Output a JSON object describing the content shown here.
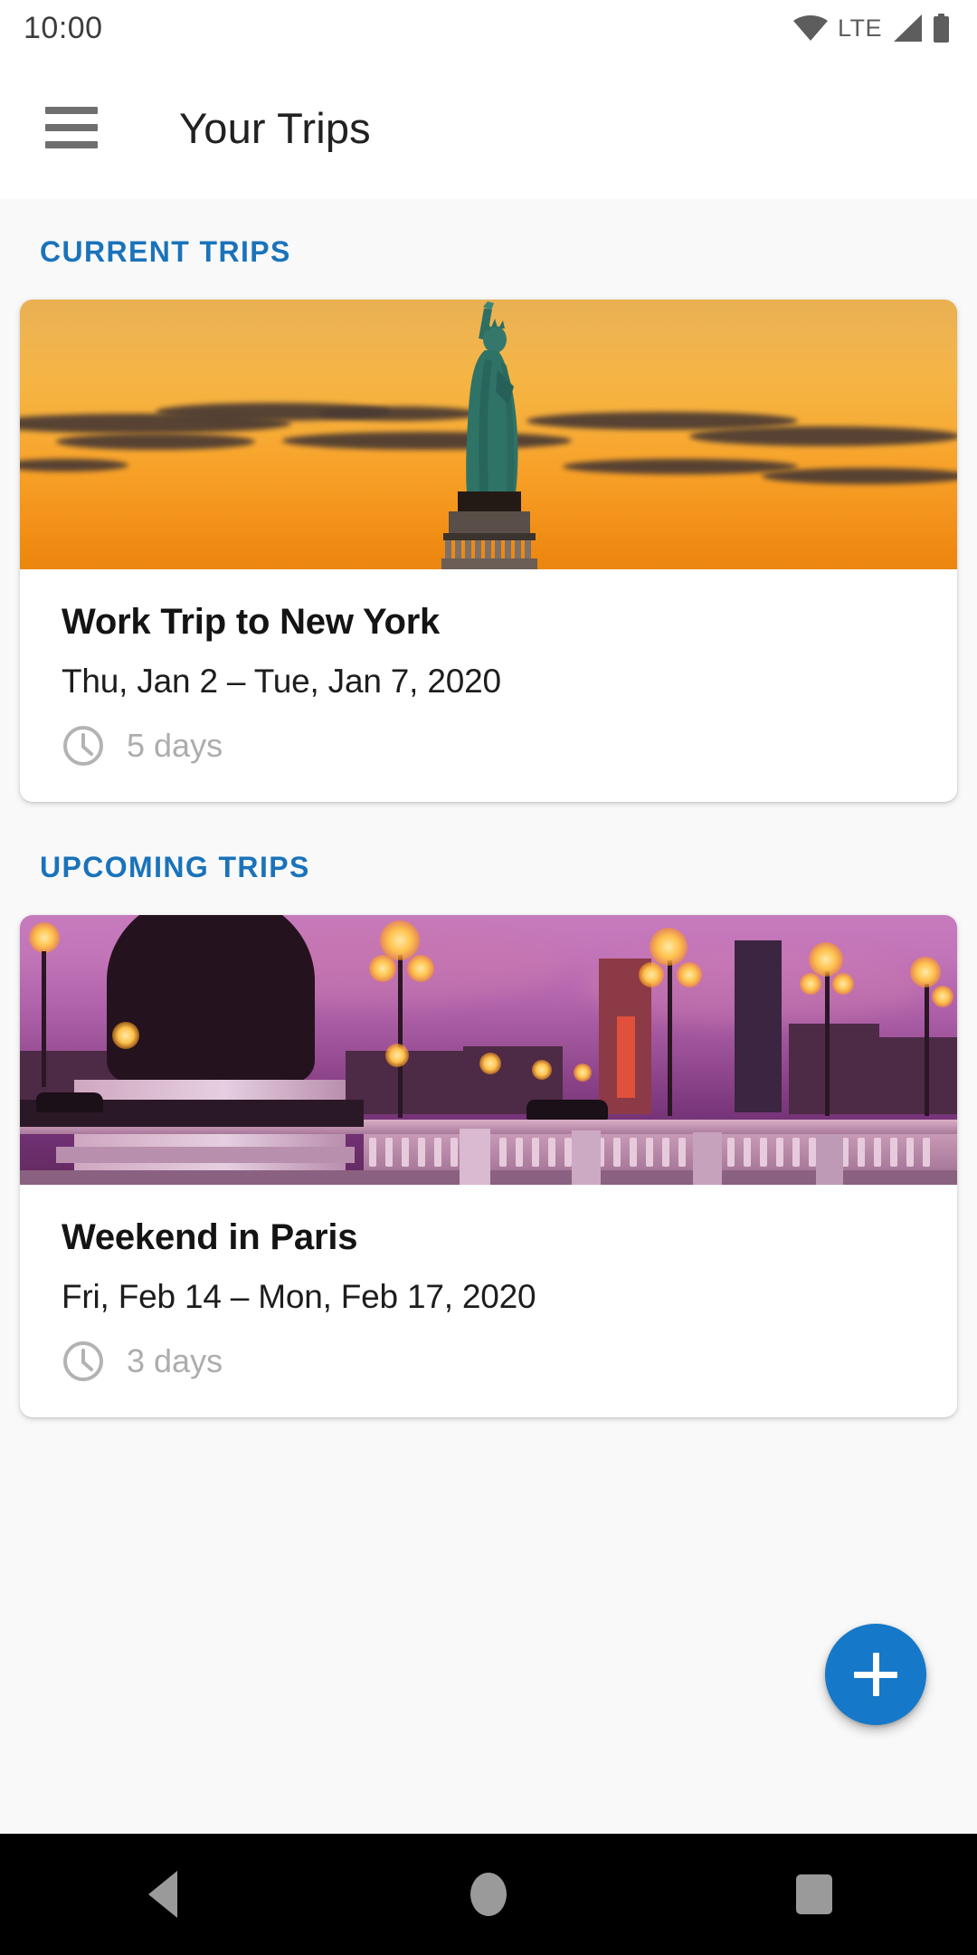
{
  "status_bar": {
    "time": "10:00",
    "network_label": "LTE",
    "icons": [
      "wifi-icon",
      "signal-icon",
      "battery-icon"
    ]
  },
  "app_bar": {
    "menu_icon": "hamburger-menu-icon",
    "title": "Your Trips"
  },
  "colors": {
    "accent_blue": "#1a73ba",
    "fab_blue": "#1578c8",
    "background": "#f9f9f9",
    "card": "#ffffff",
    "muted_text": "#adadad"
  },
  "sections": [
    {
      "id": "current",
      "header": "CURRENT TRIPS",
      "trips": [
        {
          "title": "Work Trip to New York",
          "dates": "Thu, Jan 2 – Tue, Jan 7, 2020",
          "duration": "5 days",
          "duration_icon": "clock-icon",
          "photo": "statue-of-liberty-sunset"
        }
      ]
    },
    {
      "id": "upcoming",
      "header": "UPCOMING TRIPS",
      "trips": [
        {
          "title": "Weekend in Paris",
          "dates": "Fri, Feb 14 – Mon, Feb 17, 2020",
          "duration": "3 days",
          "duration_icon": "clock-icon",
          "photo": "pont-alexandre-iii-dusk"
        }
      ]
    }
  ],
  "fab": {
    "icon": "plus-icon",
    "label": "+"
  },
  "nav_bar": {
    "buttons": [
      "back-button",
      "home-button",
      "recents-button"
    ]
  }
}
